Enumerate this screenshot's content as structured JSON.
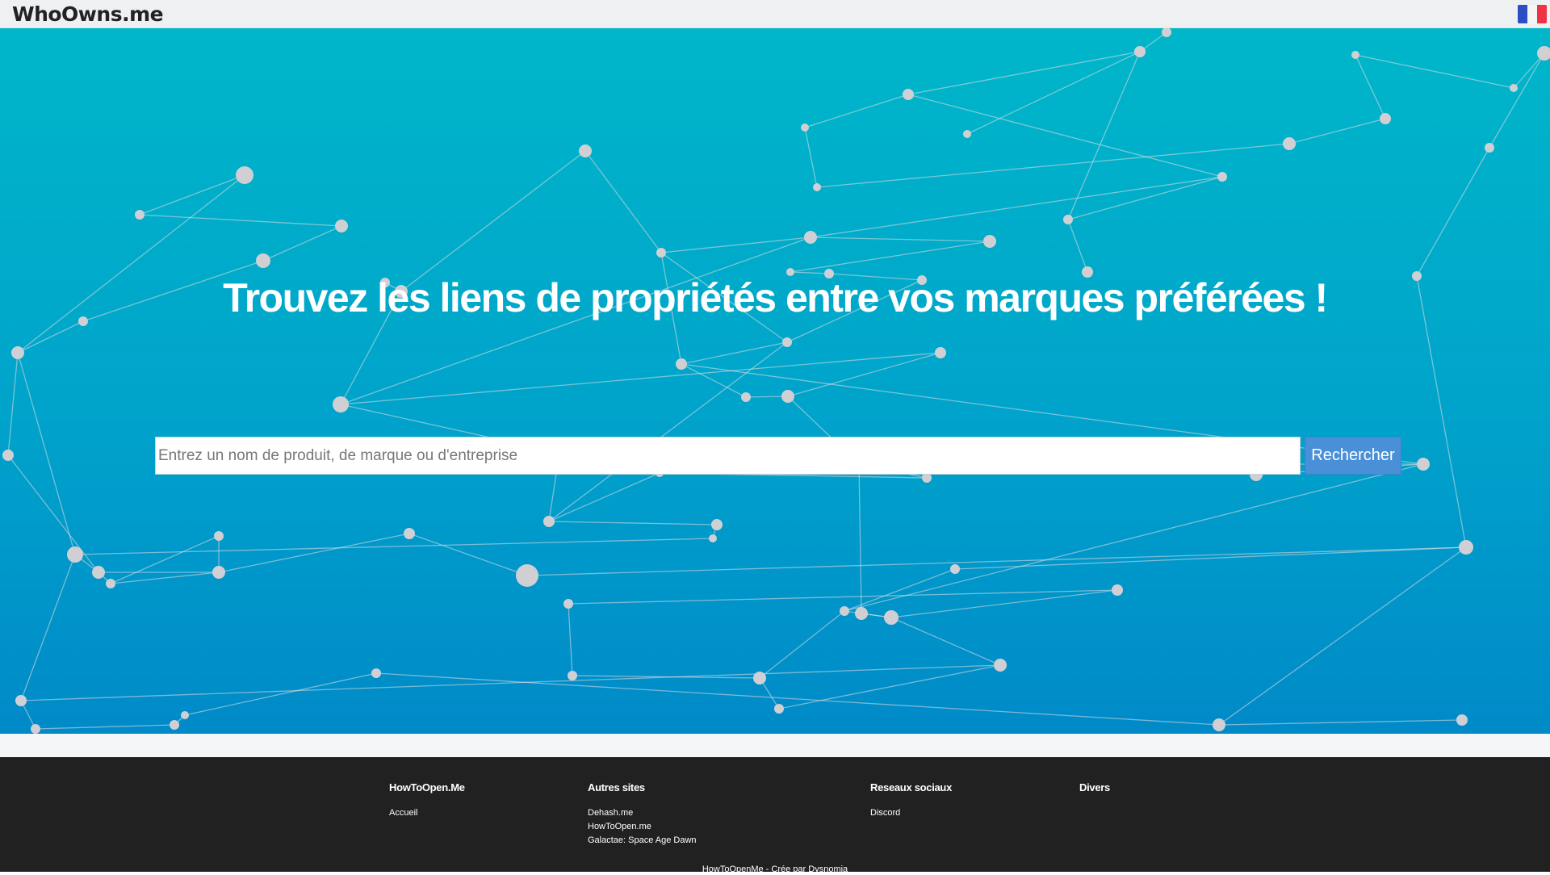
{
  "header": {
    "logo": "WhoOwns.me",
    "language_flag": "flag-fr-icon"
  },
  "hero": {
    "headline": "Trouvez les liens de propriétés entre vos marques préférées !",
    "search": {
      "placeholder": "Entrez un nom de produit, de marque ou d'entreprise",
      "value": "",
      "button_label": "Rechercher"
    }
  },
  "footer": {
    "columns": [
      {
        "title": "HowToOpen.Me",
        "links": [
          "Accueil"
        ]
      },
      {
        "title": "Autres sites",
        "links": [
          "Dehash.me",
          "HowToOpen.me",
          "Galactae: Space Age Dawn"
        ]
      },
      {
        "title": "Reseaux sociaux",
        "links": [
          "Discord"
        ]
      },
      {
        "title": "Divers",
        "links": []
      }
    ],
    "credit_text": "HowToOpenMe - Crée par ",
    "credit_link": "Dysnomia"
  },
  "colors": {
    "hero_top": "#00b6c9",
    "hero_bottom": "#008ac8",
    "button": "#4a90d9",
    "footer": "#212121"
  }
}
